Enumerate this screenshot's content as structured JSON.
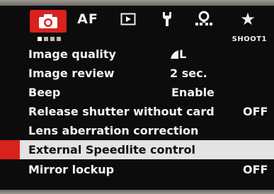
{
  "tabs": [
    {
      "id": "shoot",
      "icon": "camera-icon",
      "active": true
    },
    {
      "id": "af",
      "label": "AF"
    },
    {
      "id": "playback",
      "icon": "playback-icon"
    },
    {
      "id": "setup",
      "icon": "wrench-icon"
    },
    {
      "id": "custom",
      "icon": "custom-functions-icon"
    },
    {
      "id": "mymenu",
      "label": "★"
    }
  ],
  "page_indicator": {
    "count": 4,
    "active_index": 0
  },
  "page_label": "SHOOT1",
  "menu": [
    {
      "label": "Image quality",
      "value": "L",
      "value_icon": "fine-quality-icon"
    },
    {
      "label": "Image review",
      "value": "2 sec."
    },
    {
      "label": "Beep",
      "value": "Enable"
    },
    {
      "label": "Release shutter without card",
      "value": "OFF"
    },
    {
      "label": "Lens aberration correction",
      "value": ""
    },
    {
      "label": "External Speedlite control",
      "value": "",
      "selected": true
    },
    {
      "label": "Mirror lockup",
      "value": "OFF"
    }
  ],
  "colors": {
    "accent": "#d9211e",
    "highlight": "#e3e3e3",
    "background": "#0d0c0c",
    "text": "#f4f4f4"
  }
}
